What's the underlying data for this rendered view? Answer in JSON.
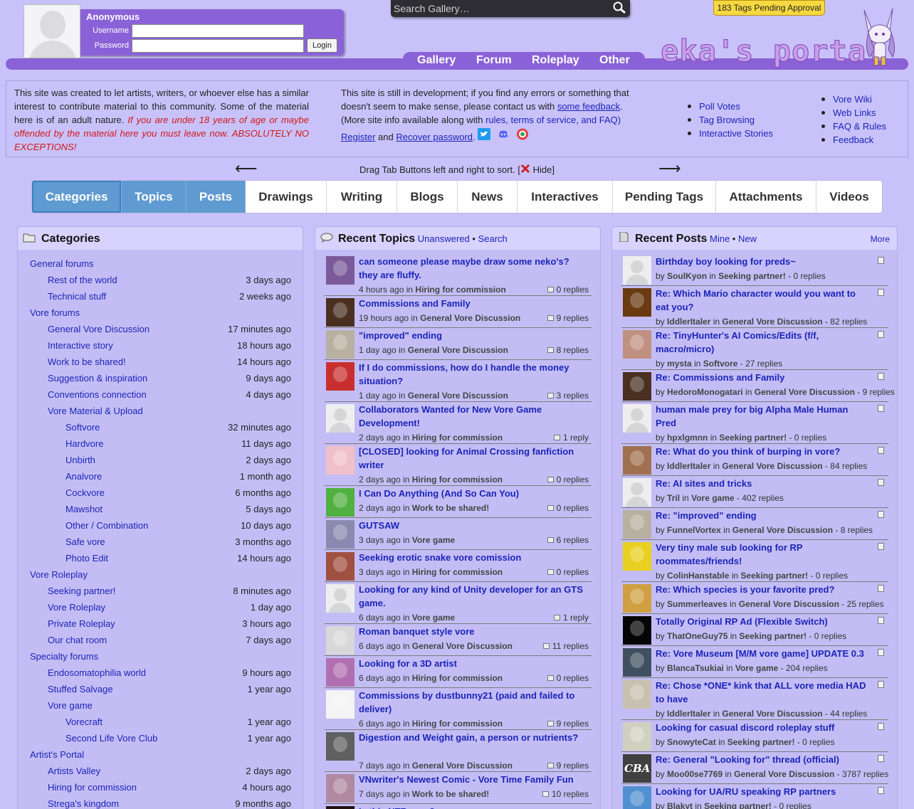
{
  "header": {
    "user": "Anonymous",
    "username_label": "Username",
    "password_label": "Password",
    "login_button": "Login",
    "search_placeholder": "Search Gallery…",
    "pending_tags": "183 Tags Pending Approval",
    "site_logo_text": "eka's portal",
    "nav": [
      "Gallery",
      "Forum",
      "Roleplay",
      "Other"
    ]
  },
  "info": {
    "left_text": "This site was created to let artists, writers, or whoever else has a similar interest to contribute material to this community. Some of the material here is of an adult nature.",
    "left_warning": "If you are under 18 years of age or maybe offended by the material here you must leave now. ABSOLUTELY NO EXCEPTIONS!",
    "mid_text1": "This site is still in development; if you find any errors or something that doesn't seem to make sense, please contact us with",
    "mid_feedback_link": "some feedback",
    "mid_text2": "(More site info available along with",
    "mid_rules_link": "rules, terms of service, and FAQ)",
    "register_link": "Register",
    "and_text": "and",
    "recover_link": "Recover password",
    "list1": [
      "Poll Votes",
      "Tag Browsing",
      "Interactive Stories"
    ],
    "list2": [
      "Vore Wiki",
      "Web Links",
      "FAQ & Rules",
      "Feedback"
    ]
  },
  "drag": {
    "text": "Drag Tab Buttons left and right to sort. [",
    "hide": "Hide]",
    "left_arrow": "⟵",
    "right_arrow": "⟶"
  },
  "tabs": [
    "Categories",
    "Topics",
    "Posts",
    "Drawings",
    "Writing",
    "Blogs",
    "News",
    "Interactives",
    "Pending Tags",
    "Attachments",
    "Videos"
  ],
  "categories": {
    "title": "Categories",
    "rows": [
      {
        "name": "General forums",
        "time": "",
        "level": 0
      },
      {
        "name": "Rest of the world",
        "time": "3 days ago",
        "level": 1
      },
      {
        "name": "Technical stuff",
        "time": "2 weeks ago",
        "level": 1
      },
      {
        "name": "Vore forums",
        "time": "",
        "level": 0
      },
      {
        "name": "General Vore Discussion",
        "time": "17 minutes ago",
        "level": 1
      },
      {
        "name": "Interactive story",
        "time": "18 hours ago",
        "level": 1
      },
      {
        "name": "Work to be shared!",
        "time": "14 hours ago",
        "level": 1
      },
      {
        "name": "Suggestion & inspiration",
        "time": "9 days ago",
        "level": 1
      },
      {
        "name": "Conventions connection",
        "time": "4 days ago",
        "level": 1
      },
      {
        "name": "Vore Material & Upload",
        "time": "",
        "level": 1
      },
      {
        "name": "Softvore",
        "time": "32 minutes ago",
        "level": 2
      },
      {
        "name": "Hardvore",
        "time": "11 days ago",
        "level": 2
      },
      {
        "name": "Unbirth",
        "time": "2 days ago",
        "level": 2
      },
      {
        "name": "Analvore",
        "time": "1 month ago",
        "level": 2
      },
      {
        "name": "Cockvore",
        "time": "6 months ago",
        "level": 2
      },
      {
        "name": "Mawshot",
        "time": "5 days ago",
        "level": 2
      },
      {
        "name": "Other / Combination",
        "time": "10 days ago",
        "level": 2
      },
      {
        "name": "Safe vore",
        "time": "3 months ago",
        "level": 2
      },
      {
        "name": "Photo Edit",
        "time": "14 hours ago",
        "level": 2
      },
      {
        "name": "Vore Roleplay",
        "time": "",
        "level": 0
      },
      {
        "name": "Seeking partner!",
        "time": "8 minutes ago",
        "level": 1
      },
      {
        "name": "Vore Roleplay",
        "time": "1 day ago",
        "level": 1
      },
      {
        "name": "Private Roleplay",
        "time": "3 hours ago",
        "level": 1
      },
      {
        "name": "Our chat room",
        "time": "7 days ago",
        "level": 1
      },
      {
        "name": "Specialty forums",
        "time": "",
        "level": 0
      },
      {
        "name": "Endosomatophilia world",
        "time": "9 hours ago",
        "level": 1
      },
      {
        "name": "Stuffed Salvage",
        "time": "1 year ago",
        "level": 1
      },
      {
        "name": "Vore game",
        "time": "",
        "level": 1
      },
      {
        "name": "Vorecraft",
        "time": "1 year ago",
        "level": 2
      },
      {
        "name": "Second Life Vore Club",
        "time": "1 year ago",
        "level": 2
      },
      {
        "name": "Artist's Portal",
        "time": "",
        "level": 0
      },
      {
        "name": "Artists Valley",
        "time": "2 days ago",
        "level": 1
      },
      {
        "name": "Hiring for commission",
        "time": "4 hours ago",
        "level": 1
      },
      {
        "name": "Strega's kingdom",
        "time": "9 months ago",
        "level": 1
      }
    ]
  },
  "topics": {
    "title": "Recent Topics",
    "unanswered": "Unanswered",
    "search": "Search",
    "in_word": "in",
    "rows": [
      {
        "title": "can someone please maybe draw some neko's? they are fluffy.",
        "time": "4 hours ago",
        "forum": "Hiring for commission",
        "replies": "0 replies",
        "color": "#7a5a9a"
      },
      {
        "title": "Commissions and Family",
        "time": "19 hours ago",
        "forum": "General Vore Discussion",
        "replies": "9 replies",
        "color": "#4a3020"
      },
      {
        "title": "\"improved\" ending",
        "time": "1 day ago",
        "forum": "General Vore Discussion",
        "replies": "8 replies",
        "color": "#b8b0a0"
      },
      {
        "title": "If I do commissions, how do I handle the money situation?",
        "time": "1 day ago",
        "forum": "General Vore Discussion",
        "replies": "3 replies",
        "color": "#c83030"
      },
      {
        "title": "Collaborators Wanted for New Vore Game Development!",
        "time": "2 days ago",
        "forum": "Hiring for commission",
        "replies": "1 reply",
        "color": ""
      },
      {
        "title": "[CLOSED] looking for Animal Crossing fanfiction writer",
        "time": "2 days ago",
        "forum": "Hiring for commission",
        "replies": "0 replies",
        "color": "#f0c0c8"
      },
      {
        "title": "I Can Do Anything (And So Can You)",
        "time": "2 days ago",
        "forum": "Work to be shared!",
        "replies": "0 replies",
        "color": "#50b040"
      },
      {
        "title": "GUTSAW",
        "time": "3 days ago",
        "forum": "Vore game",
        "replies": "6 replies",
        "color": "#8a8ab0"
      },
      {
        "title": "Seeking erotic snake vore comission",
        "time": "3 days ago",
        "forum": "Hiring for commission",
        "replies": "0 replies",
        "color": "#a05040"
      },
      {
        "title": "Looking for any kind of Unity developer for an GTS game.",
        "time": "6 days ago",
        "forum": "Vore game",
        "replies": "1 reply",
        "color": ""
      },
      {
        "title": "Roman banquet style vore",
        "time": "6 days ago",
        "forum": "General Vore Discussion",
        "replies": "11 replies",
        "color": "#d8d8d8"
      },
      {
        "title": "Looking for a 3D artist",
        "time": "6 days ago",
        "forum": "Hiring for commission",
        "replies": "0 replies",
        "color": "#b070b0"
      },
      {
        "title": "Commissions by dustbunny21 (paid and failed to deliver)",
        "time": "6 days ago",
        "forum": "Hiring for commission",
        "replies": "9 replies",
        "color": "#f4f4f4"
      },
      {
        "title": "Digestion and Weight gain, a person or nutrients?",
        "time": "7 days ago",
        "forum": "General Vore Discussion",
        "replies": "9 replies",
        "color": "#606060"
      },
      {
        "title": "VNwriter's Newest Comic - Vore Time Family Fun",
        "time": "7 days ago",
        "forum": "Work to be shared!",
        "replies": "10 replies",
        "color": "#b08aa0"
      },
      {
        "title": "Is this NTR vore?",
        "time": "",
        "forum": "",
        "replies": "",
        "color": "#201010"
      }
    ]
  },
  "posts": {
    "title": "Recent Posts",
    "mine": "Mine",
    "new": "New",
    "more": "More",
    "by_word": "by",
    "in_word": "in",
    "rows": [
      {
        "title": "Birthday boy looking for preds~",
        "user": "SoulKyon",
        "forum": "Seeking partner!",
        "replies": "0 replies",
        "color": ""
      },
      {
        "title": "Re: Which Mario character would you want to eat you?",
        "user": "IddlerItaler",
        "forum": "General Vore Discussion",
        "replies": "82 replies",
        "color": "#6a3a10"
      },
      {
        "title": "Re: TinyHunter's AI Comics/Edits (f/f, macro/micro)",
        "user": "mysta",
        "forum": "Softvore",
        "replies": "27 replies",
        "color": "#c09080"
      },
      {
        "title": "Re: Commissions and Family",
        "user": "HedoroMonogatari",
        "forum": "General Vore Discussion",
        "replies": "9 replies",
        "color": "#4a3020"
      },
      {
        "title": "human male prey for big Alpha Male Human Pred",
        "user": "hpxlgmnn",
        "forum": "Seeking partner!",
        "replies": "0 replies",
        "color": ""
      },
      {
        "title": "Re: What do you think of burping in vore?",
        "user": "IddlerItaler",
        "forum": "General Vore Discussion",
        "replies": "84 replies",
        "color": "#a07050"
      },
      {
        "title": "Re: AI sites and tricks",
        "user": "Tril",
        "forum": "Vore game",
        "replies": "402 replies",
        "color": ""
      },
      {
        "title": "Re: \"improved\" ending",
        "user": "FunnelVortex",
        "forum": "General Vore Discussion",
        "replies": "8 replies",
        "color": "#b8b0a0"
      },
      {
        "title": "Very tiny male sub looking for RP roommates/friends!",
        "user": "ColinHanstable",
        "forum": "Seeking partner!",
        "replies": "0 replies",
        "color": "#e8d020"
      },
      {
        "title": "Re: Which species is your favorite pred?",
        "user": "Summerleaves",
        "forum": "General Vore Discussion",
        "replies": "25 replies",
        "color": "#d0a040"
      },
      {
        "title": "Totally Original RP Ad (Flexible Switch)",
        "user": "ThatOneGuy75",
        "forum": "Seeking partner!",
        "replies": "0 replies",
        "color": "#050505"
      },
      {
        "title": "Re: Vore Museum [M/M vore game] UPDATE 0.3",
        "user": "BlancaTsukiai",
        "forum": "Vore game",
        "replies": "204 replies",
        "color": "#405060"
      },
      {
        "title": "Re: Chose *ONE* kink that ALL vore media HAD to have",
        "user": "IddlerItaler",
        "forum": "General Vore Discussion",
        "replies": "44 replies",
        "color": "#c8c0b0"
      },
      {
        "title": "Looking for casual discord roleplay stuff",
        "user": "SnowyteCat",
        "forum": "Seeking partner!",
        "replies": "0 replies",
        "color": "#d0d0c0"
      },
      {
        "title": "Re: General \"Looking for\" thread (official)",
        "user": "Moo00se7769",
        "forum": "General Vore Discussion",
        "replies": "3787 replies",
        "color": "#404040",
        "badge": "CBA"
      },
      {
        "title": "Looking for UA/RU speaking RP partners",
        "user": "Blakyt",
        "forum": "Seeking partner!",
        "replies": "0 replies",
        "color": "#5090d0"
      }
    ]
  }
}
